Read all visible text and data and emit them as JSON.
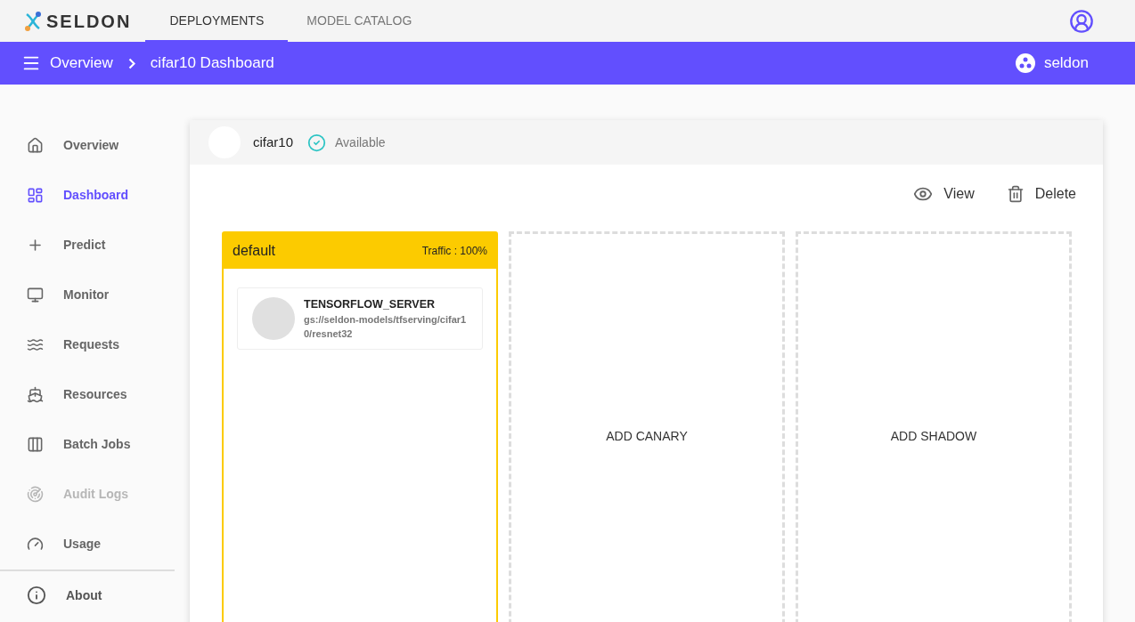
{
  "topbar": {
    "logo": "SELDON",
    "tabs": [
      {
        "label": "DEPLOYMENTS",
        "selected": true
      },
      {
        "label": "MODEL CATALOG",
        "selected": false
      }
    ]
  },
  "breadcrumb": {
    "items": [
      "Overview",
      "cifar10 Dashboard"
    ],
    "namespace": "seldon"
  },
  "sidebar": {
    "items": [
      {
        "label": "Overview",
        "selected": false,
        "disabled": false
      },
      {
        "label": "Dashboard",
        "selected": true,
        "disabled": false
      },
      {
        "label": "Predict",
        "selected": false,
        "disabled": false
      },
      {
        "label": "Monitor",
        "selected": false,
        "disabled": false
      },
      {
        "label": "Requests",
        "selected": false,
        "disabled": false
      },
      {
        "label": "Resources",
        "selected": false,
        "disabled": false
      },
      {
        "label": "Batch Jobs",
        "selected": false,
        "disabled": false
      },
      {
        "label": "Audit Logs",
        "selected": false,
        "disabled": true
      },
      {
        "label": "Usage",
        "selected": false,
        "disabled": false
      }
    ],
    "footer_item": {
      "label": "About"
    }
  },
  "deployment": {
    "name": "cifar10",
    "status": "Available",
    "actions": [
      "View",
      "Delete"
    ],
    "predictors": [
      {
        "kind": "predictor",
        "name": "default",
        "traffic": "Traffic : 100%",
        "models": [
          {
            "name": "TENSORFLOW_SERVER",
            "uri": "gs://seldon-models/tfserving/cifar10/resnet32"
          }
        ]
      },
      {
        "kind": "placeholder",
        "label": "ADD CANARY"
      },
      {
        "kind": "placeholder",
        "label": "ADD SHADOW"
      }
    ]
  }
}
